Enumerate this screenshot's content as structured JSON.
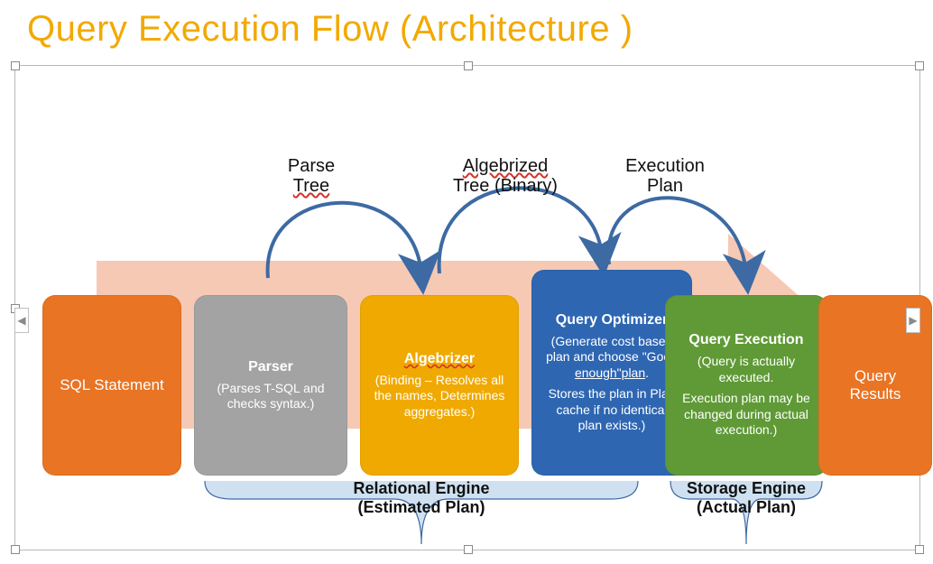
{
  "title": "Query Execution Flow (Architecture )",
  "boxes": {
    "sql": {
      "heading": "SQL Statement"
    },
    "parser": {
      "heading": "Parser",
      "text": "(Parses T-SQL and checks syntax.)"
    },
    "algebrizer": {
      "heading": "Algebrizer",
      "text": "(Binding – Resolves all the names, Determines aggregates.)"
    },
    "optimizer": {
      "heading": "Query Optimizer",
      "text1": "(Generate cost based plan and choose \"Good enough\"plan.",
      "text2": "Stores the plan in Plan cache if no identical plan exists.)"
    },
    "execution": {
      "heading": "Query Execution",
      "text1": "(Query is actually executed.",
      "text2": "Execution plan may be changed during actual execution.)"
    },
    "results": {
      "heading": "Query Results"
    }
  },
  "arcs": {
    "parse_tree": {
      "line1": "Parse",
      "line2": "Tree"
    },
    "algebrized_tree": {
      "line1": "Algebrized",
      "line2": "Tree (Binary)"
    },
    "execution_plan": {
      "line1": "Execution",
      "line2": "Plan"
    }
  },
  "braces": {
    "relational": {
      "line1": "Relational Engine",
      "line2": "(Estimated Plan)"
    },
    "storage": {
      "line1": "Storage Engine",
      "line2": "(Actual Plan)"
    }
  },
  "colors": {
    "title": "#f2a900",
    "arrow_bg": "#f6c9b4",
    "box_orange": "#e87424",
    "box_gray": "#a3a3a3",
    "box_gold": "#f0a900",
    "box_blue": "#2e66b2",
    "box_green": "#5f9a36",
    "arc_stroke": "#3d6aa3",
    "brace_fill": "#cfe1f1",
    "brace_stroke": "#3d6aa3"
  }
}
